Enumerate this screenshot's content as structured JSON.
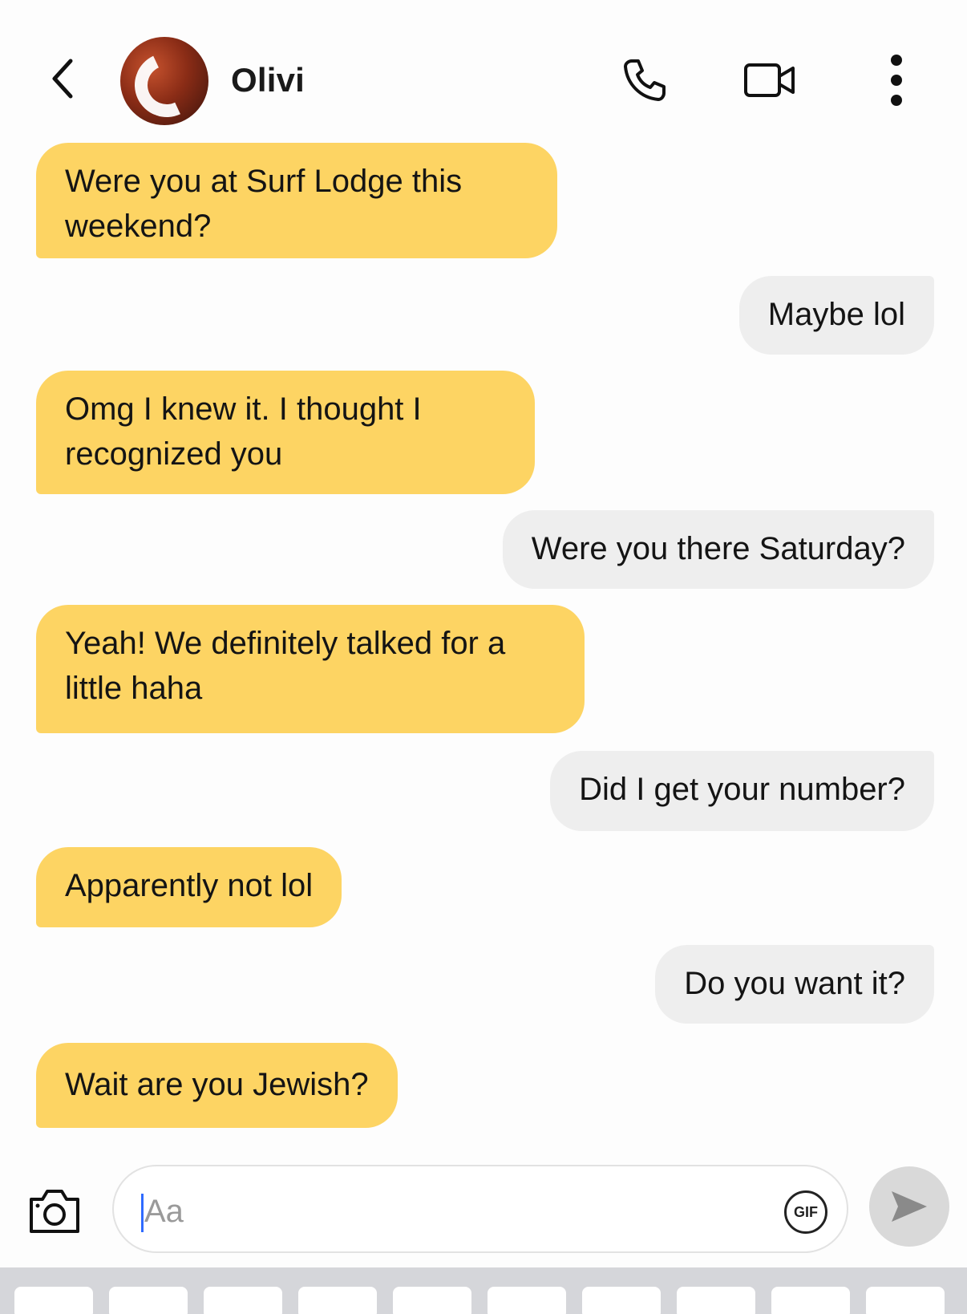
{
  "header": {
    "contact_name": "Olivi",
    "back_icon": "chevron-left-icon",
    "phone_icon": "phone-icon",
    "video_icon": "video-camera-icon",
    "more_icon": "more-vertical-icon"
  },
  "messages": [
    {
      "direction": "in",
      "text": "Were you at Surf Lodge this weekend?"
    },
    {
      "direction": "out",
      "text": "Maybe lol"
    },
    {
      "direction": "in",
      "text": "Omg I knew it. I thought I recognized you"
    },
    {
      "direction": "out",
      "text": "Were you there Saturday?"
    },
    {
      "direction": "in",
      "text": "Yeah! We definitely talked for a little haha"
    },
    {
      "direction": "out",
      "text": "Did I get your number?"
    },
    {
      "direction": "in",
      "text": "Apparently not lol"
    },
    {
      "direction": "out",
      "text": "Do you want it?"
    },
    {
      "direction": "in",
      "text": "Wait are you Jewish?"
    }
  ],
  "composer": {
    "placeholder": "Aa",
    "value": "",
    "gif_label": "GIF",
    "camera_icon": "camera-icon",
    "send_icon": "send-icon"
  },
  "colors": {
    "incoming_bubble": "#fdd463",
    "outgoing_bubble": "#eeeeee",
    "caret": "#2f6bff"
  }
}
